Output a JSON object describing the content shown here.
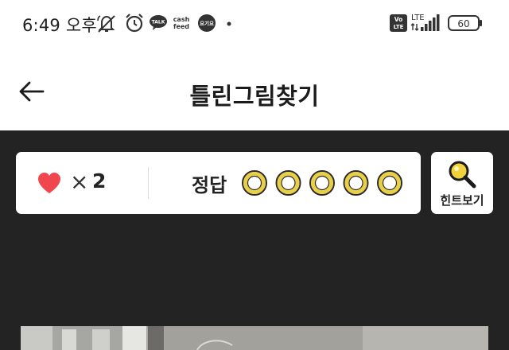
{
  "status_bar": {
    "time": "6:49 오후",
    "battery": "60",
    "network": "LTE",
    "volte": "Vo LTE",
    "icons": [
      "mute-notifications-icon",
      "alarm-icon",
      "kakaotalk-icon",
      "cashfeed-icon",
      "yogiyo-icon",
      "dot-icon",
      "volte-icon",
      "signal-icon",
      "battery-icon"
    ],
    "talk_text": "TALK",
    "cash_text": "cash",
    "feed_text": "feed",
    "yogiyo_text": "요기요"
  },
  "app_bar": {
    "title": "틀린그림찾기"
  },
  "game": {
    "lives_symbol": "×",
    "lives": "2",
    "answer_label": "정답",
    "answers_total": 5,
    "answers_found": 0,
    "hint_label": "힌트보기"
  },
  "colors": {
    "background_dark": "#232323",
    "heart": "#f0464d",
    "answer_ring": "#e8cf45",
    "hint_lens": "#f2d23c"
  }
}
